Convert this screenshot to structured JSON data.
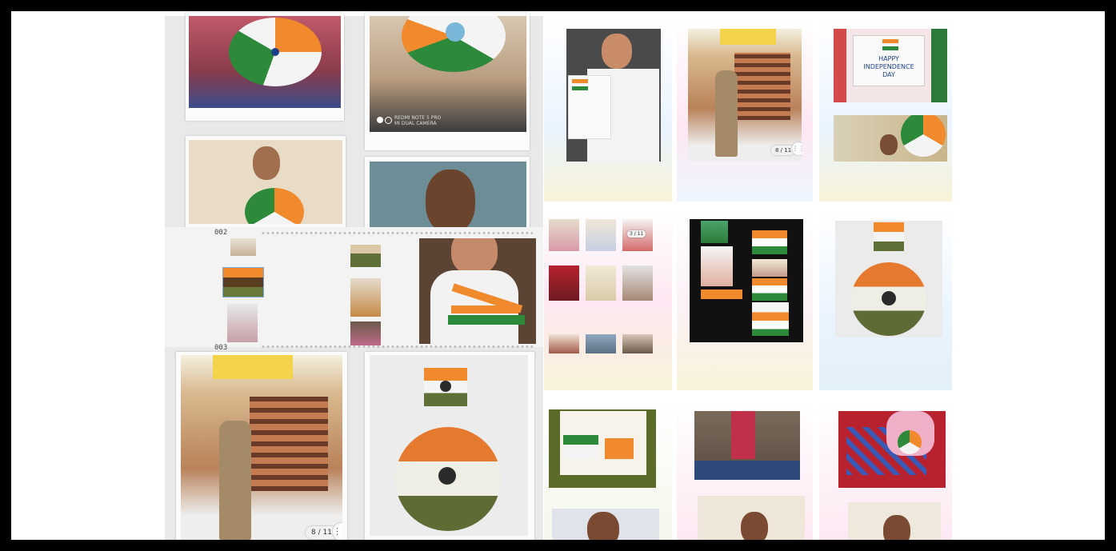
{
  "collage": {
    "left_panel": {
      "frame_numbers": [
        "002",
        "003"
      ],
      "camera_watermark": [
        "REDMI NOTE 5 PRO",
        "MI DUAL CAMERA"
      ],
      "counter": "8 / 11"
    },
    "right_panel": {
      "counter_a": "8 / 11",
      "counter_b": "3 / 11",
      "poster_text": "HAPPY INDEPENDENCE DAY"
    }
  },
  "colors": {
    "saffron": "#f08a2c",
    "white": "#f4f4f4",
    "green": "#2d8a3a",
    "navy": "#1c3f8c"
  }
}
